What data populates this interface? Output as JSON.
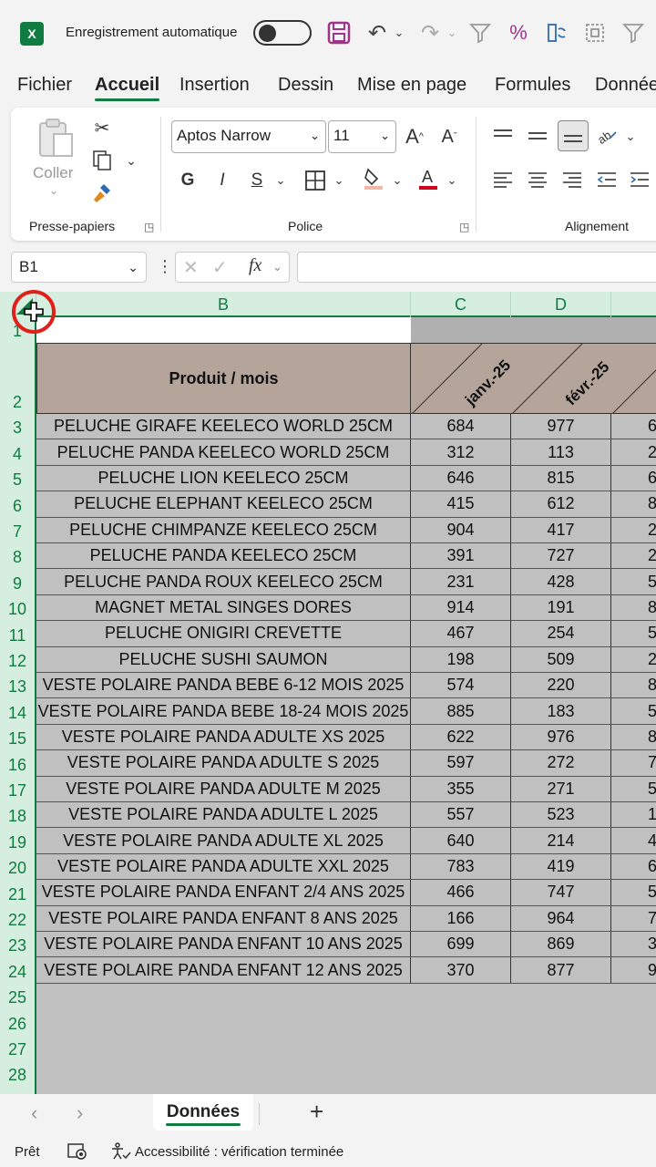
{
  "titlebar": {
    "app_logo": "X",
    "autosave_label": "Enregistrement automatique",
    "quick_icons": [
      "save-icon",
      "undo-icon",
      "redo-icon",
      "filter-clear-icon",
      "format-clear-icon",
      "refresh-icon",
      "select-icon",
      "more-icon"
    ]
  },
  "ribbon_tabs": [
    "Fichier",
    "Accueil",
    "Insertion",
    "Dessin",
    "Mise en page",
    "Formules",
    "Données"
  ],
  "ribbon": {
    "clipboard": {
      "paste_label": "Coller",
      "group_label": "Presse-papiers"
    },
    "font": {
      "font_name": "Aptos Narrow",
      "font_size": "11",
      "bold": "G",
      "italic": "I",
      "underline": "S",
      "group_label": "Police"
    },
    "alignment": {
      "group_label": "Alignement"
    }
  },
  "formula_bar": {
    "name_box": "B1",
    "fx": "fx",
    "value": ""
  },
  "columns": [
    "B",
    "C",
    "D"
  ],
  "rows": [
    "1",
    "2",
    "3",
    "4",
    "5",
    "6",
    "7",
    "8",
    "9",
    "10",
    "11",
    "12",
    "13",
    "14",
    "15",
    "16",
    "17",
    "18",
    "19",
    "20",
    "21",
    "22",
    "23",
    "24",
    "25",
    "26",
    "27",
    "28"
  ],
  "table": {
    "header": "Produit / mois",
    "months": [
      "janv.-25",
      "févr.-25"
    ],
    "rows": [
      {
        "product": "PELUCHE GIRAFE KEELECO WORLD 25CM",
        "c": "684",
        "d": "977",
        "e": "6"
      },
      {
        "product": "PELUCHE PANDA KEELECO WORLD 25CM",
        "c": "312",
        "d": "113",
        "e": "2"
      },
      {
        "product": "PELUCHE LION KEELECO 25CM",
        "c": "646",
        "d": "815",
        "e": "6"
      },
      {
        "product": "PELUCHE ELEPHANT KEELECO 25CM",
        "c": "415",
        "d": "612",
        "e": "8"
      },
      {
        "product": "PELUCHE CHIMPANZE KEELECO 25CM",
        "c": "904",
        "d": "417",
        "e": "2"
      },
      {
        "product": "PELUCHE PANDA KEELECO 25CM",
        "c": "391",
        "d": "727",
        "e": "2"
      },
      {
        "product": "PELUCHE PANDA ROUX KEELECO 25CM",
        "c": "231",
        "d": "428",
        "e": "5"
      },
      {
        "product": "MAGNET METAL SINGES DORES",
        "c": "914",
        "d": "191",
        "e": "8"
      },
      {
        "product": "PELUCHE ONIGIRI CREVETTE",
        "c": "467",
        "d": "254",
        "e": "5"
      },
      {
        "product": "PELUCHE SUSHI SAUMON",
        "c": "198",
        "d": "509",
        "e": "2"
      },
      {
        "product": "VESTE POLAIRE PANDA BEBE 6-12 MOIS 2025",
        "c": "574",
        "d": "220",
        "e": "8"
      },
      {
        "product": "VESTE POLAIRE PANDA BEBE 18-24 MOIS 2025",
        "c": "885",
        "d": "183",
        "e": "5"
      },
      {
        "product": "VESTE POLAIRE PANDA ADULTE XS 2025",
        "c": "622",
        "d": "976",
        "e": "8"
      },
      {
        "product": "VESTE POLAIRE PANDA ADULTE S 2025",
        "c": "597",
        "d": "272",
        "e": "7"
      },
      {
        "product": "VESTE POLAIRE PANDA ADULTE M 2025",
        "c": "355",
        "d": "271",
        "e": "5"
      },
      {
        "product": "VESTE POLAIRE PANDA ADULTE L 2025",
        "c": "557",
        "d": "523",
        "e": "1"
      },
      {
        "product": "VESTE POLAIRE PANDA ADULTE XL 2025",
        "c": "640",
        "d": "214",
        "e": "4"
      },
      {
        "product": "VESTE POLAIRE PANDA ADULTE XXL 2025",
        "c": "783",
        "d": "419",
        "e": "6"
      },
      {
        "product": "VESTE POLAIRE PANDA ENFANT 2/4 ANS 2025",
        "c": "466",
        "d": "747",
        "e": "5"
      },
      {
        "product": "VESTE POLAIRE PANDA ENFANT 8 ANS 2025",
        "c": "166",
        "d": "964",
        "e": "7"
      },
      {
        "product": "VESTE POLAIRE PANDA ENFANT 10 ANS 2025",
        "c": "699",
        "d": "869",
        "e": "3"
      },
      {
        "product": "VESTE POLAIRE PANDA ENFANT 12 ANS 2025",
        "c": "370",
        "d": "877",
        "e": "9"
      }
    ]
  },
  "sheet_tabs": {
    "active": "Données",
    "add": "+"
  },
  "status": {
    "ready": "Prêt",
    "accessibility": "Accessibilité : vérification terminée"
  },
  "colors": {
    "excel_green": "#107c41",
    "header_fill": "#b4a49a",
    "cell_fill": "#c0c0c0"
  }
}
